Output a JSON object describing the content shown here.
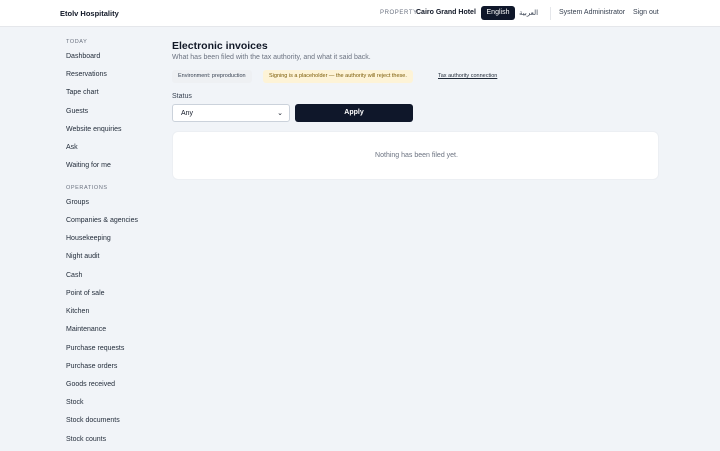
{
  "header": {
    "brand": "Etolv Hospitality",
    "property_label": "PROPERTY",
    "property_name": "Cairo Grand Hotel",
    "lang_active": "English",
    "lang_other": "العربية",
    "user": "System Administrator",
    "sign_out": "Sign out"
  },
  "sidebar": {
    "today_title": "TODAY",
    "today_items": [
      "Dashboard",
      "Reservations",
      "Tape chart",
      "Guests",
      "Website enquiries",
      "Ask",
      "Waiting for me"
    ],
    "operations_title": "OPERATIONS",
    "operations_items": [
      "Groups",
      "Companies & agencies",
      "Housekeeping",
      "Night audit",
      "Cash",
      "Point of sale",
      "Kitchen",
      "Maintenance",
      "Purchase requests",
      "Purchase orders",
      "Goods received",
      "Stock",
      "Stock documents",
      "Stock counts"
    ]
  },
  "main": {
    "title": "Electronic invoices",
    "subtitle": "What has been filed with the tax authority, and what it said back.",
    "environment": "Environment: preproduction",
    "warning": "Signing is a placeholder — the authority will reject these.",
    "tax_link": "Tax authority connection",
    "status_label": "Status",
    "status_value": "Any",
    "apply_label": "Apply",
    "empty_message": "Nothing has been filed yet."
  }
}
